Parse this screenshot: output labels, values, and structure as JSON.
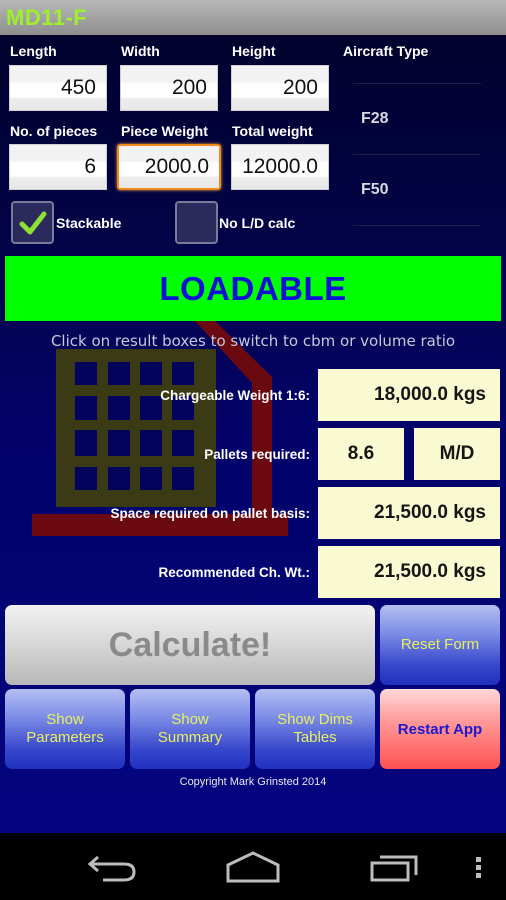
{
  "app": {
    "title": "MD11-F"
  },
  "inputs": {
    "length": {
      "label": "Length",
      "value": "450"
    },
    "width": {
      "label": "Width",
      "value": "200"
    },
    "height": {
      "label": "Height",
      "value": "200"
    },
    "pieces": {
      "label": "No. of pieces",
      "value": "6"
    },
    "piece_weight": {
      "label": "Piece Weight",
      "value": "2000.0"
    },
    "total_weight": {
      "label": "Total weight",
      "value": "12000.0"
    }
  },
  "aircraft": {
    "label": "Aircraft Type",
    "options": [
      "F28",
      "F50"
    ]
  },
  "options": {
    "stackable": {
      "label": "Stackable",
      "checked": true
    },
    "no_ld_calc": {
      "label": "No L/D calc",
      "checked": false
    }
  },
  "status": {
    "text": "LOADABLE",
    "color": "#00ff00"
  },
  "hint": "Click on result boxes to switch to cbm or volume ratio",
  "results": {
    "chargeable_weight": {
      "label": "Chargeable Weight 1:6:",
      "value": "18,000.0 kgs"
    },
    "pallets_required": {
      "label": "Pallets required:",
      "value": "8.6",
      "deck": "M/D"
    },
    "space_required": {
      "label": "Space required on pallet basis:",
      "value": "21,500.0 kgs"
    },
    "recommended": {
      "label": "Recommended Ch. Wt.:",
      "value": "21,500.0 kgs"
    }
  },
  "buttons": {
    "calculate": "Calculate!",
    "reset": "Reset Form",
    "show_parameters": "Show Parameters",
    "show_summary": "Show Summary",
    "show_dims": "Show Dims Tables",
    "restart": "Restart App"
  },
  "footer": {
    "copyright": "Copyright Mark Grinsted 2014"
  },
  "navbar": {
    "icons": [
      "back-icon",
      "home-icon",
      "recent-apps-icon",
      "overflow-menu-icon"
    ]
  }
}
